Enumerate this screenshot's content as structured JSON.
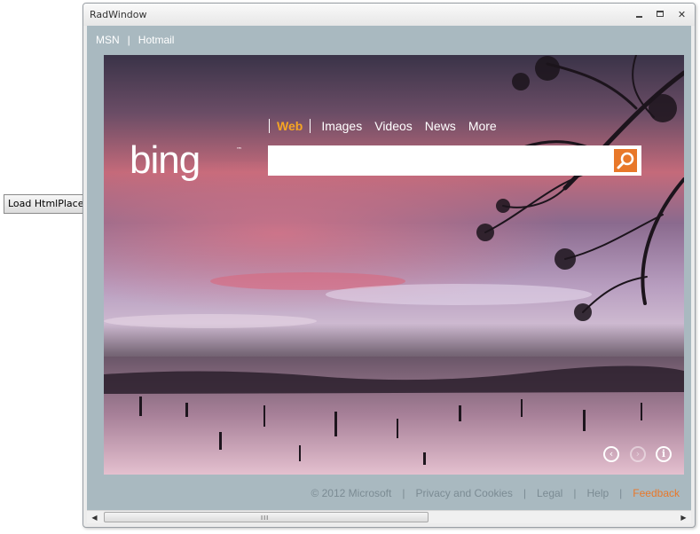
{
  "outside": {
    "load_button_label": "Load HtmlPlaceholder"
  },
  "window": {
    "title": "RadWindow",
    "controls": {
      "minimize": "minimize-icon",
      "maximize": "maximize-icon",
      "close": "close-icon"
    }
  },
  "page": {
    "topnav": {
      "items": [
        "MSN",
        "Hotmail"
      ],
      "separator": "|"
    },
    "tabs": [
      "Web",
      "Images",
      "Videos",
      "News",
      "More"
    ],
    "active_tab": "Web",
    "logo": "bing",
    "search": {
      "value": "",
      "button_icon": "search-icon"
    },
    "image_controls": {
      "prev": "‹",
      "next": "›",
      "info": "i"
    },
    "footer": {
      "copyright": "© 2012 Microsoft",
      "links": [
        "Privacy and Cookies",
        "Legal",
        "Help"
      ],
      "feedback": "Feedback",
      "separator": "|"
    },
    "colors": {
      "accent": "#e8782a",
      "active_tab": "#f6a623",
      "content_bg": "#a9b9c0"
    }
  },
  "scrollbar": {
    "grip": "III"
  }
}
